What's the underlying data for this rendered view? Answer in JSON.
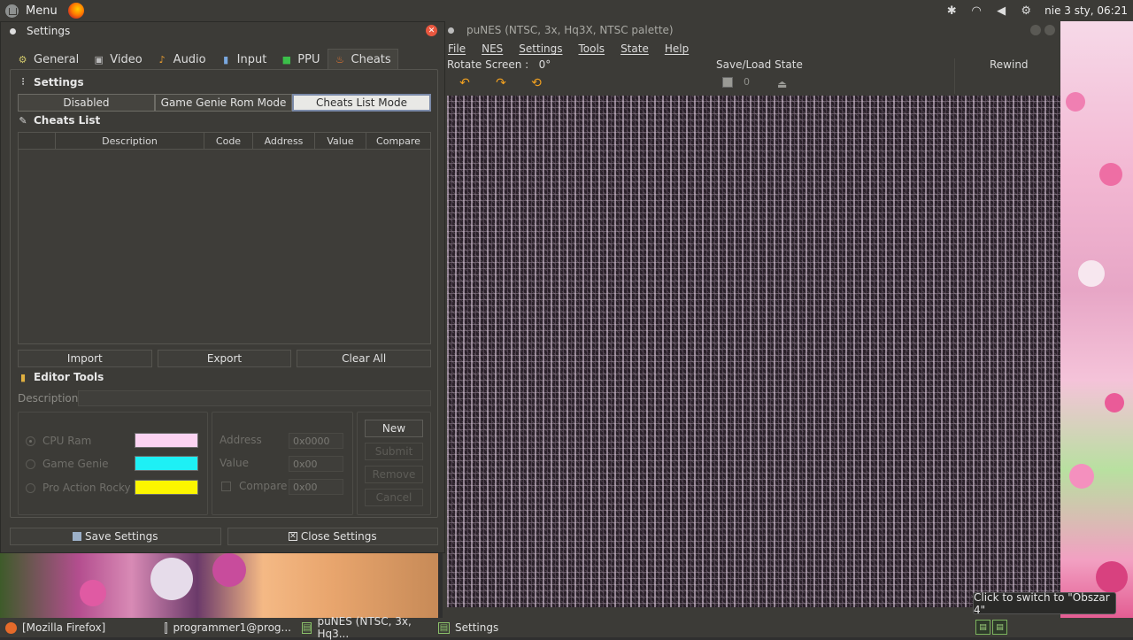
{
  "top_panel": {
    "menu_label": "Menu",
    "clock": "nie 3 sty, 06:21",
    "tray_icons": [
      "bluetooth-icon",
      "wifi-icon",
      "volume-icon",
      "gear-icon"
    ]
  },
  "punes": {
    "title": "puNES (NTSC, 3x, Hq3X, NTSC palette)",
    "menus": [
      "File",
      "NES",
      "Settings",
      "Tools",
      "State",
      "Help"
    ],
    "rotate_label": "Rotate Screen :",
    "rotate_value": "0°",
    "saveload_label": "Save/Load State",
    "slot_value": "0",
    "rewind_label": "Rewind"
  },
  "settings": {
    "title": "Settings",
    "tabs": [
      {
        "label": "General",
        "icon": "general-icon"
      },
      {
        "label": "Video",
        "icon": "video-icon"
      },
      {
        "label": "Audio",
        "icon": "audio-icon"
      },
      {
        "label": "Input",
        "icon": "input-icon"
      },
      {
        "label": "PPU",
        "icon": "ppu-icon"
      },
      {
        "label": "Cheats",
        "icon": "cheats-icon"
      }
    ],
    "active_tab": "Cheats",
    "settings_heading": "Settings",
    "modes": [
      "Disabled",
      "Game Genie Rom Mode",
      "Cheats List Mode"
    ],
    "active_mode": "Cheats List Mode",
    "cheats_list_heading": "Cheats List",
    "columns": [
      "",
      "Description",
      "Code",
      "Address",
      "Value",
      "Compare"
    ],
    "rows": [],
    "list_buttons": [
      "Import",
      "Export",
      "Clear All"
    ],
    "editor_heading": "Editor Tools",
    "description_label": "Description",
    "description_value": "",
    "types": [
      {
        "label": "CPU Ram",
        "color": "#fcd3f2",
        "checked": true
      },
      {
        "label": "Game Genie",
        "color": "#1ef0f5",
        "checked": false
      },
      {
        "label": "Pro Action Rocky",
        "color": "#fcf600",
        "checked": false
      }
    ],
    "address_label": "Address",
    "address_value": "0x0000",
    "value_label": "Value",
    "value_value": "0x00",
    "compare_label": "Compare",
    "compare_value": "0x00",
    "side_buttons": [
      "New",
      "Submit",
      "Remove",
      "Cancel"
    ],
    "save_button": "Save Settings",
    "close_button": "Close Settings"
  },
  "tooltip": "Click to switch to \"Obszar 4\"",
  "taskbar": {
    "tasks": [
      {
        "label": "[Mozilla Firefox]",
        "icon": "firefox-icon"
      },
      {
        "label": "programmer1@prog...",
        "icon": "terminal-icon"
      },
      {
        "label": "puNES (NTSC, 3x, Hq3...",
        "icon": "punes-icon"
      },
      {
        "label": "Settings",
        "icon": "punes-icon"
      }
    ]
  }
}
